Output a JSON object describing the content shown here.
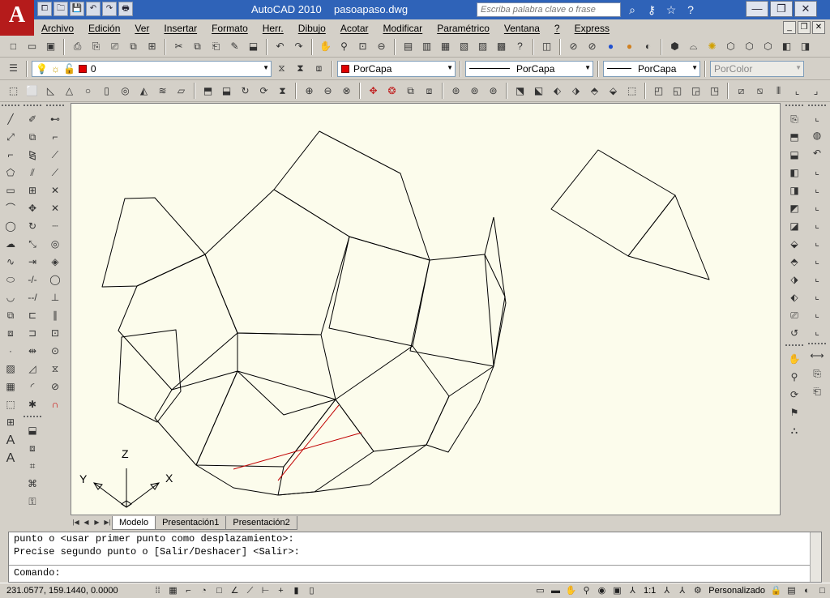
{
  "titlebar": {
    "logo": "A",
    "app": "AutoCAD 2010",
    "file": "pasoapaso.dwg",
    "search_placeholder": "Escriba palabra clave o frase",
    "qat": [
      "⧠",
      "🗀",
      "💾",
      "↶",
      "↷",
      "🖶"
    ]
  },
  "window": {
    "minimize": "—",
    "restore": "❐",
    "close": "✕"
  },
  "menu": [
    "Archivo",
    "Edición",
    "Ver",
    "Insertar",
    "Formato",
    "Herr.",
    "Dibujo",
    "Acotar",
    "Modificar",
    "Paramétrico",
    "Ventana",
    "?",
    "Express"
  ],
  "props": {
    "layer": "0",
    "color": "PorCapa",
    "linetype": "PorCapa",
    "lineweight": "PorCapa",
    "plotstyle": "PorColor"
  },
  "tabs": [
    "Modelo",
    "Presentación1",
    "Presentación2"
  ],
  "ucs": {
    "z": "Z",
    "y": "Y",
    "x": "X"
  },
  "command": {
    "line1": "punto o <usar primer punto como desplazamiento>:",
    "line2": "Precise segundo punto o [Salir/Deshacer] <Salir>:",
    "prompt": "Comando:"
  },
  "status": {
    "coords": "231.0577, 159.1440, 0.0000",
    "scale": "1:1",
    "workspace": "Personalizado"
  },
  "colors": {
    "title": "#2f63b8",
    "canvas": "#fcfcec",
    "accent_red": "#c00000"
  }
}
